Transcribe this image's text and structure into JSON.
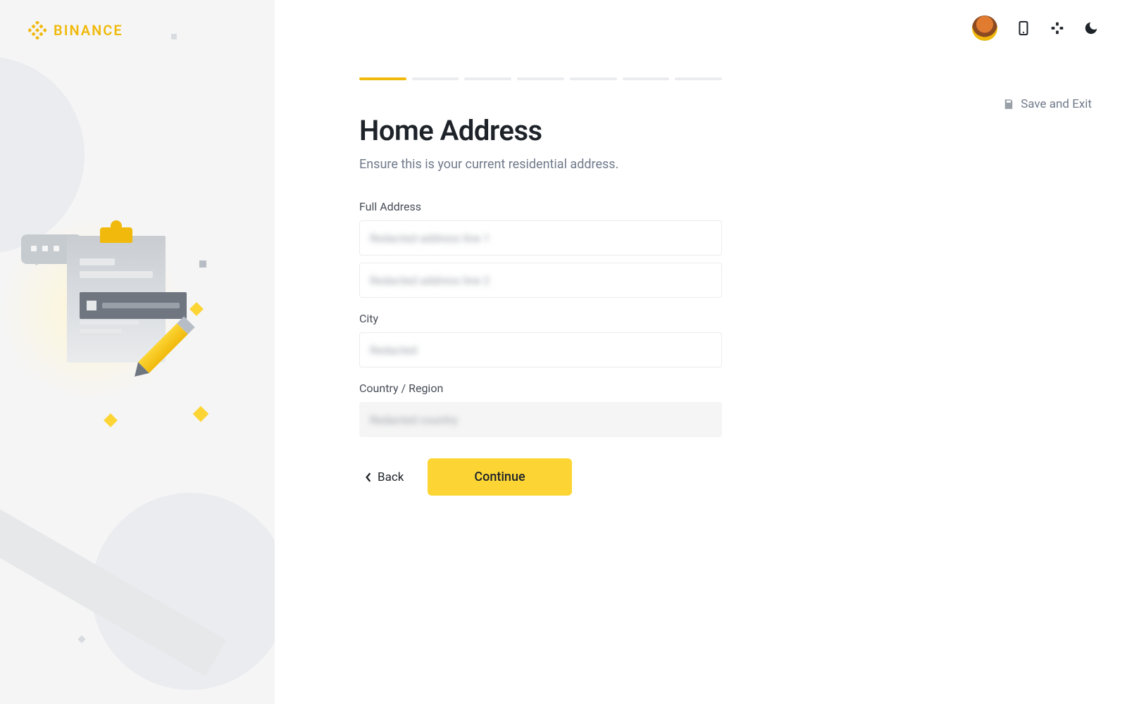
{
  "brand": "BINANCE",
  "progress": {
    "total_steps": 7,
    "current_step": 1
  },
  "save_exit_label": "Save and Exit",
  "page": {
    "title": "Home Address",
    "subtitle": "Ensure this is your current residential address."
  },
  "form": {
    "full_address_label": "Full Address",
    "address_line1": "Redacted address line 1",
    "address_line2": "Redacted address line 2",
    "city_label": "City",
    "city_value": "Redacted",
    "country_label": "Country / Region",
    "country_value": "Redacted country"
  },
  "actions": {
    "back_label": "Back",
    "continue_label": "Continue"
  },
  "icons": {
    "avatar": "avatar-icon",
    "mobile": "mobile-icon",
    "globe": "globe-icon",
    "moon": "moon-icon",
    "save": "save-icon",
    "chevron_left": "chevron-left-icon"
  }
}
